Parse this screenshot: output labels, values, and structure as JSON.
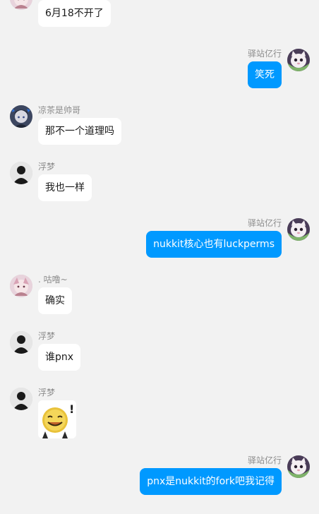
{
  "colors": {
    "background": "#f2f2f2",
    "bubble_self": "#0099ff",
    "bubble_other": "#ffffff",
    "nickname": "#8c8c8c"
  },
  "messages": [
    {
      "side": "left",
      "sender": "",
      "avatar": "anime-girl-avatar",
      "text": "6月18不开了"
    },
    {
      "side": "right",
      "sender": "驿站亿行",
      "avatar": "cat-avatar",
      "text": "笑死"
    },
    {
      "side": "left",
      "sender": "凉茶是帅哥",
      "avatar": "dark-anime-avatar",
      "text": "那不一个道理吗"
    },
    {
      "side": "left",
      "sender": "浮梦",
      "avatar": "silhouette-avatar",
      "text": "我也一样"
    },
    {
      "side": "right",
      "sender": "驿站亿行",
      "avatar": "cat-avatar",
      "text": "nukkit核心也有luckperms"
    },
    {
      "side": "left",
      "sender": ". 咕噜~",
      "avatar": "anime-girl-avatar",
      "text": "确实"
    },
    {
      "side": "left",
      "sender": "浮梦",
      "avatar": "silhouette-avatar",
      "text": "谁pnx"
    },
    {
      "side": "left",
      "sender": "浮梦",
      "avatar": "silhouette-avatar",
      "sticker": "smiling-coin-face-sticker",
      "sticker_mark": "!"
    },
    {
      "side": "right",
      "sender": "驿站亿行",
      "avatar": "cat-avatar",
      "text": "pnx是nukkit的fork吧我记得"
    }
  ]
}
